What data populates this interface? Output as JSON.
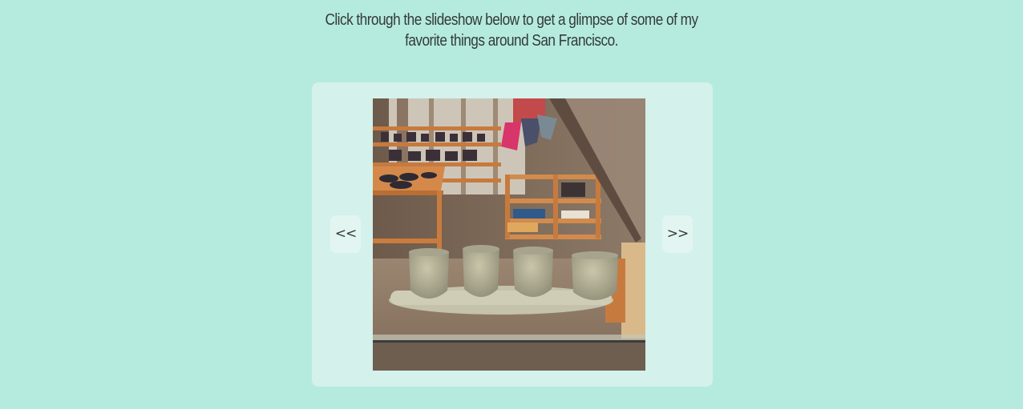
{
  "intro": {
    "text": "Click through the slideshow below to get a glimpse of some of my favorite things around San Francisco."
  },
  "slideshow": {
    "prev_label": "<<",
    "next_label": ">>",
    "current_slide": {
      "description_icon": "photo-ceramic-cups-shop"
    }
  },
  "colors": {
    "background": "#b5ebde",
    "panel": "#d4f1eb",
    "button": "#e3f5f1",
    "text": "#333a3a"
  }
}
